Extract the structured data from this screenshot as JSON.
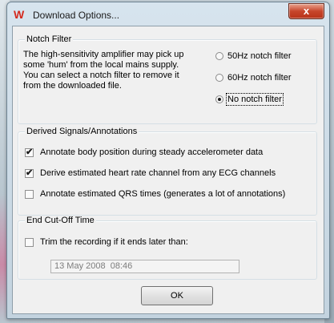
{
  "window": {
    "title": "Download Options...",
    "close_glyph": "x"
  },
  "app_icon": {
    "name": "w-logo-icon",
    "glyph": "W",
    "color": "#d42a1e"
  },
  "notch_filter": {
    "label": "Notch Filter",
    "description": [
      "The high-sensitivity amplifier may pick up",
      "some 'hum' from the local mains supply.",
      "You can select a notch filter to remove it",
      "from the downloaded file."
    ],
    "options": [
      {
        "label": "50Hz notch filter",
        "selected": false
      },
      {
        "label": "60Hz notch filter",
        "selected": false
      },
      {
        "label": "No notch filter",
        "selected": true
      }
    ]
  },
  "derived": {
    "label": "Derived Signals/Annotations",
    "checks": [
      {
        "label": "Annotate body position during steady accelerometer data",
        "checked": true,
        "mark": "✔"
      },
      {
        "label": "Derive estimated heart rate channel from any ECG channels",
        "checked": true,
        "mark": "✔"
      },
      {
        "label": "Annotate estimated QRS times (generates a lot of annotations)",
        "checked": false,
        "mark": ""
      }
    ]
  },
  "end_cutoff": {
    "label": "End Cut-Off Time",
    "trim_label": "Trim the recording if it ends later than:",
    "trim_checked": false,
    "date_value": "13 May 2008  08:46"
  },
  "buttons": {
    "ok_label": "OK"
  }
}
